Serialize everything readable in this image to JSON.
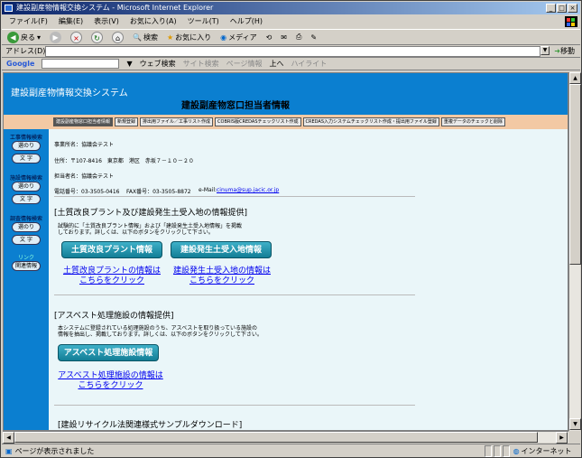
{
  "window": {
    "title": "建設副産物情報交換システム - Microsoft Internet Explorer"
  },
  "menu": [
    "ファイル(F)",
    "編集(E)",
    "表示(V)",
    "お気に入り(A)",
    "ツール(T)",
    "ヘルプ(H)"
  ],
  "toolbar": {
    "back": "戻る",
    "search": "検索",
    "favorites": "お気に入り",
    "media": "メディア"
  },
  "address": {
    "label": "アドレス(D)",
    "value": "",
    "go": "移動"
  },
  "google": {
    "logo": "Google",
    "web_search": "ウェブ検索",
    "site_search": "サイト検索",
    "page_info": "ページ情報",
    "up": "上へ",
    "highlight": "ハイライト"
  },
  "site": {
    "title": "建設副産物情報交換システム",
    "page_title": "建設副産物窓口担当者情報"
  },
  "tabs": [
    "建設副産物窓口担当者情報",
    "新規登録",
    "排出用ファイル／工事リスト作成",
    "COBRIS版CREDASチェックリスト作成",
    "CREDAS入力システムチェックリスト作成・提出用ファイル登録",
    "重複データのチェックと削除"
  ],
  "sidebar": {
    "koji_header": "工事情報検索",
    "koji_b1": "選のり",
    "koji_b2": "文 字",
    "shisetsu_header": "施設情報検索",
    "shisetsu_b1": "選のり",
    "shisetsu_b2": "文 字",
    "chosa_header": "調査情報検索",
    "chosa_b1": "選のり",
    "chosa_b2": "文 字",
    "link_header": "リンク",
    "link_b1": "関連情報"
  },
  "office": {
    "name": "事業所名：協議会テスト",
    "address": "住所：〒107-8416　東京都　港区　赤坂７－１０－２０",
    "person": "担当者名：協議会テスト",
    "tel": "電話番号：03-3505-0416",
    "fax": "FAX番号：03-3505-8872",
    "email_label": "e-Mail:",
    "email": "cinuma@sup.jacic.or.jp"
  },
  "section1": {
    "heading": "[土質改良プラント及び建設発生土受入地の情報提供]",
    "desc_line1": "試験的に「土質改良プラント情報」および「建設発生土受入地情報」を掲載",
    "desc_line2": "しております。詳しくは、以下のボタンをクリックして下さい。",
    "btn1": "土質改良プラント情報",
    "btn2": "建設発生土受入地情報",
    "link1_line1": "土質改良プラントの情報は",
    "link1_line2": "こちらをクリック",
    "link2_line1": "建設発生土受入地の情報は",
    "link2_line2": "こちらをクリック"
  },
  "section2": {
    "heading": "[アスベスト処理施設の情報提供]",
    "desc_line1": "本システムに登録されている処理施設のうち、アスベストを取り扱っている施設の",
    "desc_line2": "情報を抽出し、掲載しております。詳しくは、以下のボタンをクリックして下さい。",
    "btn": "アスベスト処理施設情報",
    "link_line1": "アスベスト処理施設の情報は",
    "link_line2": "こちらをクリック"
  },
  "section3": {
    "heading": "[建設リサイクル法関連様式サンプルダウンロード]"
  },
  "status": {
    "text": "ページが表示されました",
    "zone": "インターネット"
  }
}
